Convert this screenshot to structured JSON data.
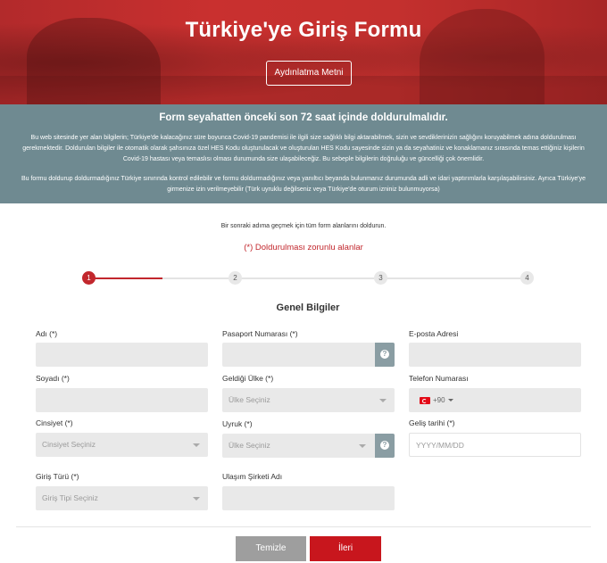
{
  "header": {
    "title": "Türkiye'ye Giriş Formu",
    "privacy_button": "Aydınlatma Metni"
  },
  "notice": {
    "title": "Form seyahatten önceki son 72 saat içinde doldurulmalıdır.",
    "paragraph1": "Bu web sitesinde yer alan bilgilerin; Türkiye'de kalacağınız süre boyunca Covid-19 pandemisi ile ilgili size sağlıklı bilgi aktarabilmek, sizin ve sevdiklerinizin sağlığını koruyabilmek adına doldurulması gerekmektedir. Doldurulan bilgiler ile otomatik olarak şahsınıza özel HES Kodu oluşturulacak ve oluşturulan HES Kodu sayesinde sizin ya da seyahatiniz ve konaklamanız sırasında temas ettiğiniz kişilerin Covid-19 hastası veya temaslısı olması durumunda size ulaşabileceğiz. Bu sebeple bilgilerin doğruluğu ve güncelliği çok önemlidir.",
    "paragraph2": "Bu formu doldurup doldurmadığınız Türkiye sınırında kontrol edilebilir ve formu doldurmadığınız veya yanıltıcı beyanda bulunmanız durumunda adli ve idari yaptırımlarla karşılaşabilirsiniz. Ayrıca Türkiye'ye girmenize izin verilmeyebilir (Türk uyruklu değilseniz veya Türkiye'de oturum izniniz bulunmuyorsa)"
  },
  "form": {
    "instruction": "Bir sonraki adıma geçmek için tüm form alanlarını doldurun.",
    "required_note": "(*) Doldurulması zorunlu alanlar",
    "steps": [
      "1",
      "2",
      "3",
      "4"
    ],
    "current_step": 1,
    "section_title": "Genel Bilgiler",
    "fields": {
      "first_name": {
        "label": "Adı (*)",
        "value": ""
      },
      "passport": {
        "label": "Pasaport Numarası (*)",
        "value": ""
      },
      "email": {
        "label": "E-posta Adresi",
        "value": ""
      },
      "last_name": {
        "label": "Soyadı (*)",
        "value": ""
      },
      "origin_country": {
        "label": "Geldiği Ülke (*)",
        "placeholder": "Ülke Seçiniz"
      },
      "phone": {
        "label": "Telefon Numarası",
        "dial_code": "+90"
      },
      "gender": {
        "label": "Cinsiyet (*)",
        "placeholder": "Cinsiyet Seçiniz"
      },
      "nationality": {
        "label": "Uyruk (*)",
        "placeholder": "Ülke Seçiniz"
      },
      "arrival_date": {
        "label": "Geliş tarihi (*)",
        "placeholder": "YYYY/MM/DD"
      },
      "entry_type": {
        "label": "Giriş Türü (*)",
        "placeholder": "Giriş Tipi Seçiniz"
      },
      "carrier": {
        "label": "Ulaşım Şirketi Adı",
        "value": ""
      }
    },
    "buttons": {
      "clear": "Temizle",
      "next": "İleri"
    }
  },
  "colors": {
    "accent": "#c2272d",
    "notice_bg": "#6f8a91",
    "field_bg": "#e9e9e9",
    "help_bg": "#8a9da3"
  }
}
